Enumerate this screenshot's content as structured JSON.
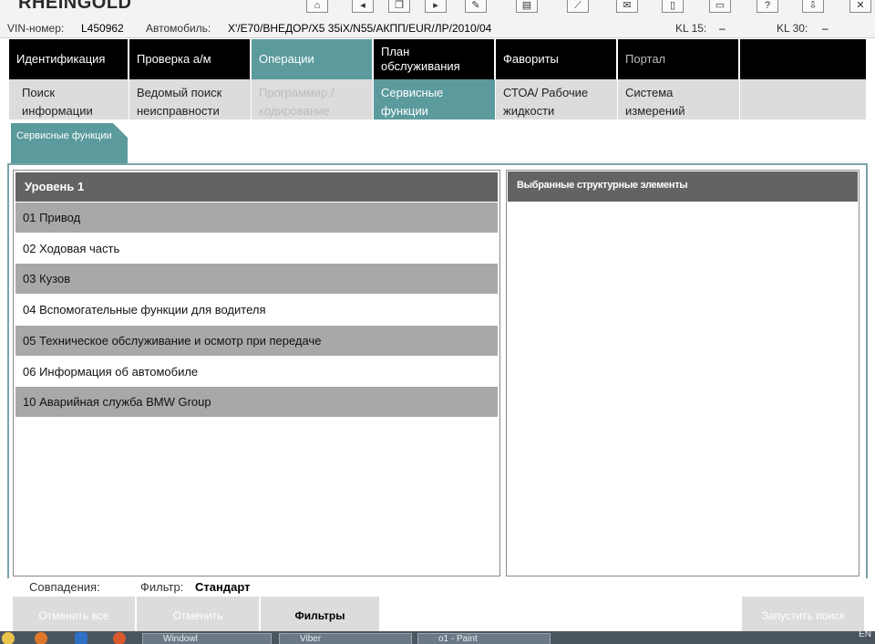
{
  "app": {
    "brand": "RHEINGOLD"
  },
  "toolbar_icons": [
    "home-icon",
    "back-icon",
    "copy-icon",
    "forward-icon",
    "edit-icon",
    "print-preview-icon",
    "measure-icon",
    "mail-icon",
    "document-icon",
    "printer-icon",
    "help-icon",
    "download-icon",
    "close-icon"
  ],
  "vehicle": {
    "vin_label": "VIN-номер:",
    "vin_value": "L450962",
    "car_label": "Автомобиль:",
    "car_value": "X'/E70/ВНЕДОР/X5 35iX/N55/АКПП/EUR/ЛР/2010/04",
    "kl15_label": "KL 15:",
    "kl15_value": "–",
    "kl30_label": "KL 30:",
    "kl30_value": "–"
  },
  "main_tabs": [
    {
      "label": "Идентификация"
    },
    {
      "label": "Проверка а/м"
    },
    {
      "label": "Операции"
    },
    {
      "label": "План обслуживания"
    },
    {
      "label": "Фавориты"
    },
    {
      "label": "Портал"
    }
  ],
  "sub_tabs": [
    {
      "label": "Поиск информации"
    },
    {
      "label": "Ведомый поиск неисправности"
    },
    {
      "label": "Программир./ кодирование"
    },
    {
      "label": "Сервисные функции"
    },
    {
      "label": "СТОА/ Рабочие жидкости"
    },
    {
      "label": "Система измерений"
    }
  ],
  "section_tab": {
    "label": "Сервисные функции"
  },
  "left_panel": {
    "header": "Уровень 1",
    "rows": [
      "01 Привод",
      "02 Ходовая часть",
      "03 Кузов",
      "04 Вспомогательные функции для водителя",
      "05 Техническое обслуживание и осмотр при передаче",
      "06 Информация об автомобиле",
      "10 Аварийная служба BMW Group"
    ]
  },
  "right_panel": {
    "header": "Выбранные структурные элементы"
  },
  "status": {
    "matches_label": "Совпадения:",
    "filter_label": "Фильтр:",
    "filter_value": "Стандарт"
  },
  "buttons": {
    "cancel_all": "Отменить все",
    "cancel": "Отменить",
    "filters": "Фильтры",
    "start_search": "Запустить поиск"
  },
  "taskbar": {
    "items": [
      "Windowl",
      "Viber",
      "o1 - Paint"
    ],
    "lang": "EN"
  }
}
